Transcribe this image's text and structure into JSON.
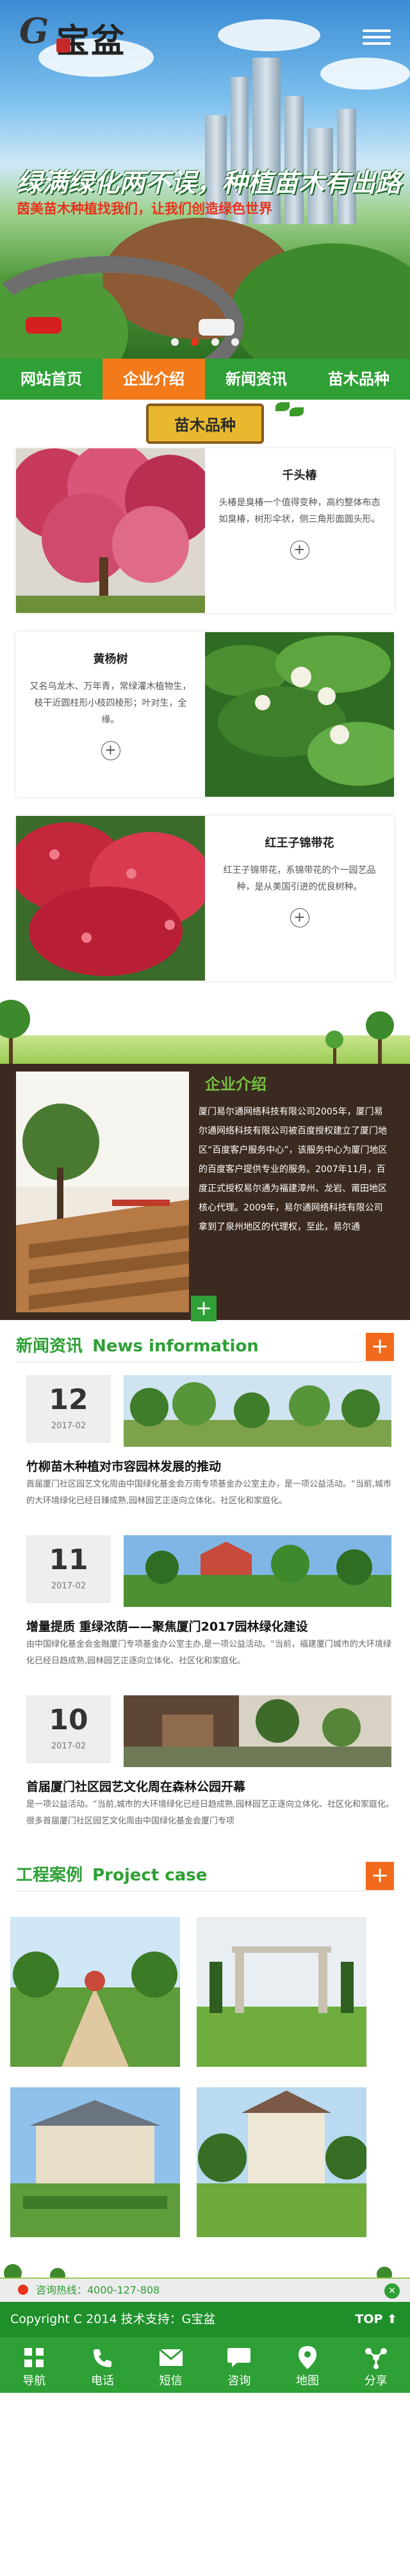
{
  "header": {
    "logo_initial": "G",
    "logo_text": "宝盆",
    "slogan": "绿满绿化两不误，种植苗木有出路",
    "subslogan": "茵美苗木种植找我们，让我们创造绿色世界",
    "slides": 4,
    "active_slide": 2
  },
  "nav": {
    "items": [
      {
        "label": "网站首页",
        "active": false
      },
      {
        "label": "企业介绍",
        "active": true
      },
      {
        "label": "新闻资讯",
        "active": false
      },
      {
        "label": "苗木品种",
        "active": false
      }
    ]
  },
  "categories": {
    "title": "苗木品种",
    "items": [
      {
        "name": "千头椿",
        "desc": "头椿是臭椿一个值得变种，高约整体布态如臭椿，树形伞状，侧三角形面圆头形。",
        "image_side": "left"
      },
      {
        "name": "黄杨树",
        "desc": "又名乌龙木、万年青，常绿灌木植物生，枝干近圆柱形小枝四棱形；叶对生，全缘。",
        "image_side": "right"
      },
      {
        "name": "红王子锦带花",
        "desc": "红王子锦带花，系锦带花的个一园艺品种，是从美国引进的优良树种。",
        "image_side": "left"
      }
    ]
  },
  "about": {
    "title": "企业介绍",
    "text": "厦门易尔通网络科技有限公司2005年，厦门易尔通网络科技有限公司被百度授权建立了厦门地区“百度客户服务中心”，该服务中心为厦门地区的百度客户提供专业的服务。2007年11月，百度正式授权易尔通为福建漳州、龙岩、莆田地区核心代理。2009年，易尔通网络科技有限公司拿到了泉州地区的代理权，至此，易尔通"
  },
  "news": {
    "title_cn": "新闻资讯",
    "title_en": "News information",
    "items": [
      {
        "day": "12",
        "ym": "2017-02",
        "title": "竹柳苗木种植对市容园林发展的推动",
        "desc": "首届厦门社区园艺文化周由中国绿化基金会万南专项基金办公室主办，是一项公益活动。“当前,城市的大环境绿化已经日臻成熟,园林园艺正逐向立体化、社区化和家庭化。"
      },
      {
        "day": "11",
        "ym": "2017-02",
        "title": "增量提质 重绿浓荫——聚焦厦门2017园林绿化建设",
        "desc": "由中国绿化基金会金融厦门专项基金办公室主办,是一项公益活动。“当前，福建厦门城市的大环境绿化已经日趋成熟,园林园艺正逐向立体化、社区化和家庭化。"
      },
      {
        "day": "10",
        "ym": "2017-02",
        "title": "首届厦门社区园艺文化周在森林公园开幕",
        "desc": "是一项公益活动。“当前,城市的大环境绿化已经日趋成熟,园林园艺正逐向立体化、社区化和家庭化。很多首届厦门社区园艺文化周由中国绿化基金会厦门专项"
      }
    ]
  },
  "cases": {
    "title_cn": "工程案例",
    "title_en": "Project case",
    "items": [
      "garden-1",
      "garden-2",
      "garden-3",
      "garden-4"
    ]
  },
  "contact": {
    "label": "咨询热线：4000-127-808"
  },
  "footer": {
    "copyright": "Copyright C 2014 技术支持：G宝盆",
    "top": "TOP ⬆",
    "nav": [
      {
        "label": "导航",
        "icon": "grid-icon"
      },
      {
        "label": "电话",
        "icon": "phone-icon"
      },
      {
        "label": "短信",
        "icon": "mail-icon"
      },
      {
        "label": "咨询",
        "icon": "chat-icon"
      },
      {
        "label": "地图",
        "icon": "map-pin-icon"
      },
      {
        "label": "分享",
        "icon": "share-icon"
      }
    ]
  },
  "colors": {
    "green": "#2ea035",
    "orange": "#f27a1b",
    "red": "#e8321b"
  }
}
